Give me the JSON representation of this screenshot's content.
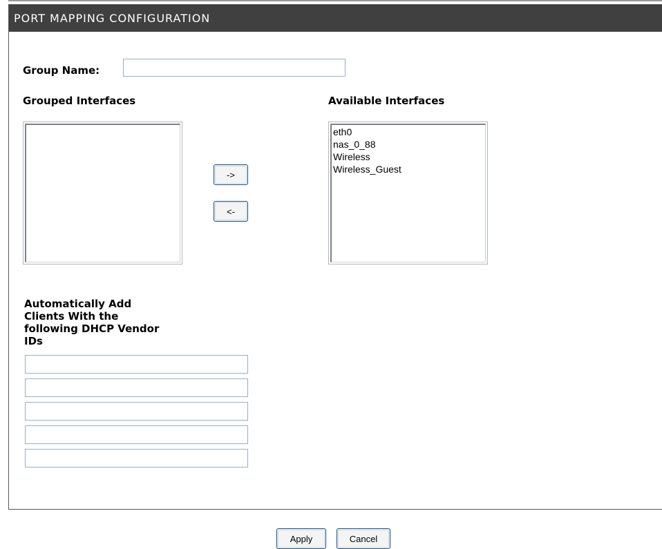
{
  "header": {
    "title": "PORT MAPPING CONFIGURATION"
  },
  "form": {
    "group_name_label": "Group Name:",
    "group_name_value": "",
    "grouped_label": "Grouped Interfaces",
    "available_label": "Available Interfaces",
    "grouped_items": [],
    "available_items": [
      "eth0",
      "nas_0_88",
      "Wireless",
      "Wireless_Guest"
    ],
    "move_right_label": "->",
    "move_left_label": "<-",
    "vendor_label_lines": [
      "Automatically Add",
      "Clients With the",
      "following DHCP Vendor",
      "IDs"
    ],
    "vendor_values": [
      "",
      "",
      "",
      "",
      ""
    ]
  },
  "footer": {
    "apply_label": "Apply",
    "cancel_label": "Cancel"
  }
}
